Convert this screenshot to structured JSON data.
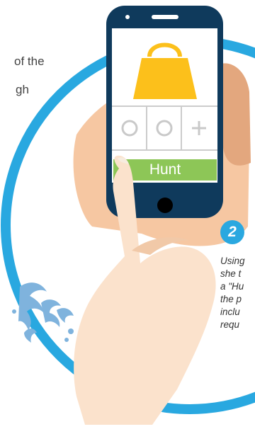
{
  "intro": {
    "line1": "of the",
    "line2": "gh"
  },
  "step": {
    "number": "2",
    "lines": [
      "Using",
      "she t",
      "a \"Hu",
      "the p",
      "inclu",
      "requ"
    ]
  },
  "app": {
    "hunt_button_label": "Hunt",
    "slot_icons": [
      "circle-icon",
      "circle-icon",
      "plus-icon"
    ],
    "product_icon": "handbag-icon"
  },
  "colors": {
    "accent_ring": "#29a8e0",
    "phone_body": "#0f3a5c",
    "hunt_button": "#8dc657",
    "handbag": "#fcc01b",
    "skin": "#f7c9a4",
    "water": "#7fb3dd"
  }
}
